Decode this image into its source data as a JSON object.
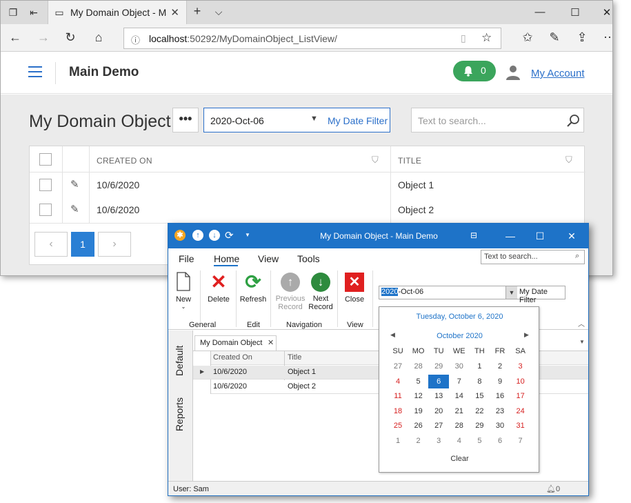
{
  "browser": {
    "tab_title": "My Domain Object - Ma",
    "url_host": "localhost",
    "url_path": ":50292/MyDomainObject_ListView/"
  },
  "app": {
    "name": "Main Demo",
    "notification_count": "0",
    "account_label": "My Account",
    "page_title": "My Domain Object",
    "more_label": "•••",
    "date_filter_value": "2020-Oct-06",
    "date_filter_label": "My Date Filter",
    "search_placeholder": "Text to search...",
    "columns": [
      "CREATED ON",
      "TITLE"
    ],
    "rows": [
      {
        "created_on": "10/6/2020",
        "title": "Object 1"
      },
      {
        "created_on": "10/6/2020",
        "title": "Object 2"
      }
    ],
    "pager": {
      "prev": "‹",
      "current": "1",
      "next": "›"
    }
  },
  "win": {
    "title": "My Domain Object - Main Demo",
    "menus": [
      "File",
      "Home",
      "View",
      "Tools"
    ],
    "search_placeholder": "Text to search...",
    "ribbon": {
      "new": "New",
      "delete": "Delete",
      "refresh": "Refresh",
      "prev1": "Previous",
      "prev2": "Record",
      "next1": "Next",
      "next2": "Record",
      "close": "Close",
      "groups": [
        "General",
        "Edit",
        "Navigation",
        "View"
      ]
    },
    "date_filter_sel": "2020",
    "date_filter_rest": "-Oct-06",
    "date_filter_label": "My Date Filter",
    "side_tabs": [
      "Default",
      "Reports"
    ],
    "doc_tab": "My Domain Object",
    "grid_columns": [
      "Created On",
      "Title"
    ],
    "grid_rows": [
      {
        "created_on": "10/6/2020",
        "title": "Object 1"
      },
      {
        "created_on": "10/6/2020",
        "title": "Object 2"
      }
    ],
    "status_user": "User: Sam",
    "status_count": "0"
  },
  "calendar": {
    "today_label": "Tuesday, October 6, 2020",
    "month_label": "October 2020",
    "days_of_week": [
      "SU",
      "MO",
      "TU",
      "WE",
      "TH",
      "FR",
      "SA"
    ],
    "weeks": [
      [
        "27",
        "28",
        "29",
        "30",
        "1",
        "2",
        "3"
      ],
      [
        "4",
        "5",
        "6",
        "7",
        "8",
        "9",
        "10"
      ],
      [
        "11",
        "12",
        "13",
        "14",
        "15",
        "16",
        "17"
      ],
      [
        "18",
        "19",
        "20",
        "21",
        "22",
        "23",
        "24"
      ],
      [
        "25",
        "26",
        "27",
        "28",
        "29",
        "30",
        "31"
      ],
      [
        "1",
        "2",
        "3",
        "4",
        "5",
        "6",
        "7"
      ]
    ],
    "selected_day": "6",
    "clear_label": "Clear"
  },
  "colors": {
    "accent": "#1e73c8",
    "web_accent": "#2a6fc9",
    "badge_green": "#3ba55c",
    "weekend_red": "#d62020"
  }
}
